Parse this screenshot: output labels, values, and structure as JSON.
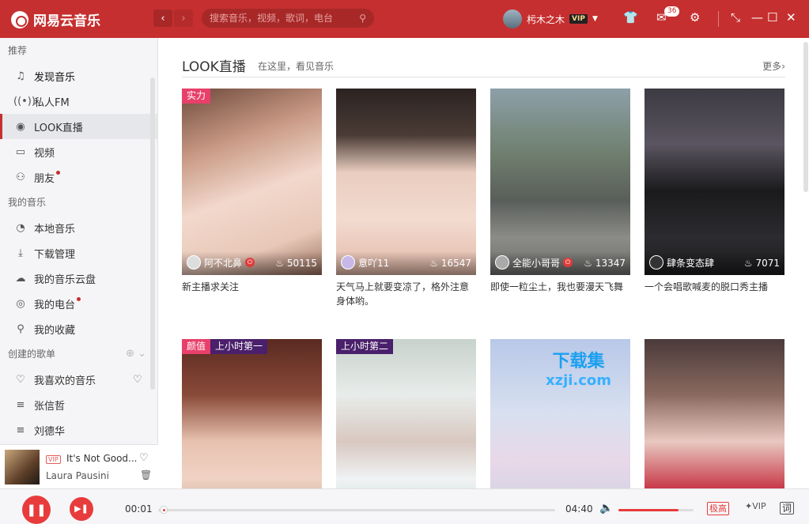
{
  "app": {
    "title": "网易云音乐"
  },
  "search": {
    "placeholder": "搜索音乐，视频，歌词，电台"
  },
  "user": {
    "name": "杇木之木",
    "vip": "VIP",
    "message_count": "36"
  },
  "sidebar": {
    "sections": [
      {
        "title": "推荐",
        "items": [
          {
            "label": "发现音乐",
            "icon": "music-note-icon"
          },
          {
            "label": "私人FM",
            "icon": "radio-icon"
          },
          {
            "label": "LOOK直播",
            "icon": "live-icon"
          },
          {
            "label": "视频",
            "icon": "video-icon"
          },
          {
            "label": "朋友",
            "icon": "friends-icon"
          }
        ]
      },
      {
        "title": "我的音乐",
        "items": [
          {
            "label": "本地音乐",
            "icon": "local-music-icon"
          },
          {
            "label": "下载管理",
            "icon": "download-icon"
          },
          {
            "label": "我的音乐云盘",
            "icon": "cloud-icon"
          },
          {
            "label": "我的电台",
            "icon": "podcast-icon"
          },
          {
            "label": "我的收藏",
            "icon": "collect-icon"
          }
        ]
      },
      {
        "title": "创建的歌单",
        "items": [
          {
            "label": "我喜欢的音乐",
            "icon": "heart-icon"
          },
          {
            "label": "张信哲",
            "icon": "playlist-icon"
          },
          {
            "label": "刘德华",
            "icon": "playlist-icon"
          }
        ]
      }
    ]
  },
  "now_playing": {
    "vip": "VIP",
    "title": "It's Not Good...",
    "artist": "Laura Pausini"
  },
  "main": {
    "title": "LOOK直播",
    "subtitle": "在这里，看见音乐",
    "more": "更多",
    "cards": [
      {
        "tags": [
          "实力"
        ],
        "host": "阿不北鼻",
        "count": "50115",
        "desc": "新主播求关注"
      },
      {
        "tags": [],
        "host": "意吖11",
        "count": "16547",
        "desc": "天气马上就要变凉了，格外注意身体哟。"
      },
      {
        "tags": [],
        "host": "全能小哥哥",
        "count": "13347",
        "desc": "即使一粒尘土，我也要漫天飞舞"
      },
      {
        "tags": [],
        "host": "肆条变态肆",
        "count": "7071",
        "desc": "一个会唱歌喊麦的脱口秀主播"
      },
      {
        "tags": [
          "颜值",
          "上小时第一"
        ],
        "host": "",
        "count": "",
        "desc": ""
      },
      {
        "tags": [
          "上小时第二"
        ],
        "host": "",
        "count": "",
        "desc": ""
      },
      {
        "tags": [],
        "host": "",
        "count": "",
        "desc": ""
      },
      {
        "tags": [],
        "host": "",
        "count": "",
        "desc": ""
      }
    ],
    "watermark": {
      "line1": "下载集",
      "line2": "xzji.com"
    }
  },
  "player": {
    "current_time": "00:01",
    "total_time": "04:40",
    "progress": 0.0036,
    "volume": 0.8,
    "quality": "极高",
    "lyric": "词"
  },
  "colors": {
    "brand": "#c62f2f",
    "accent": "#e83c3c"
  }
}
